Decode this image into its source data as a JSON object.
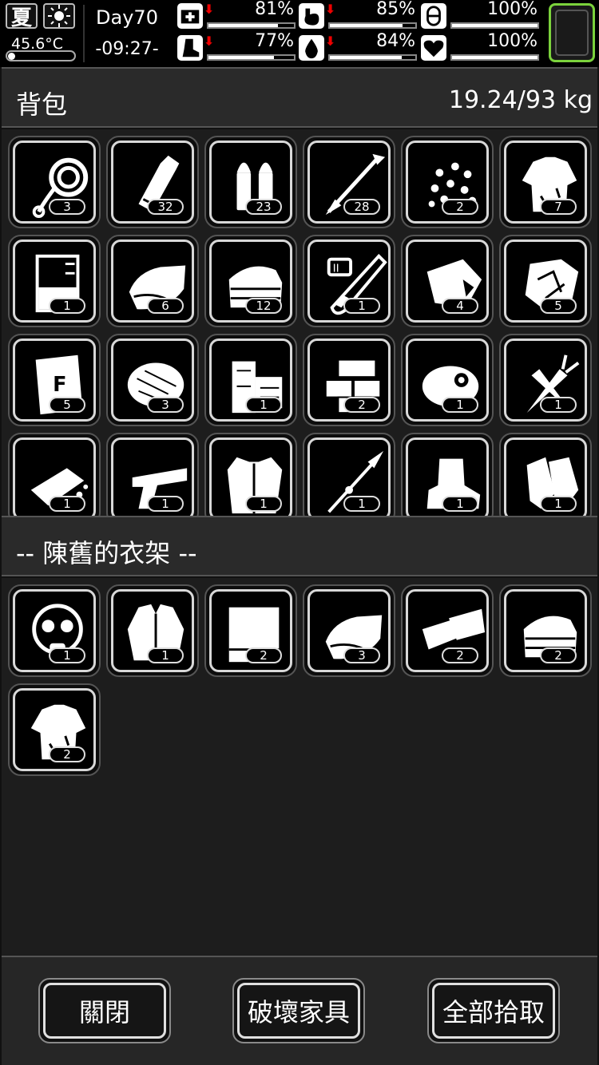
{
  "hud": {
    "season": "夏",
    "weather_icon": "sun-icon",
    "temperature": "45.6°C",
    "day": "Day70",
    "time": "-09:27-",
    "stats": [
      {
        "id": "health",
        "icon": "medkit-icon",
        "value": "81%",
        "fill": 0.81,
        "falling": true
      },
      {
        "id": "hunger",
        "icon": "stomach-icon",
        "value": "85%",
        "fill": 0.85,
        "falling": true
      },
      {
        "id": "medicine",
        "icon": "pill-icon",
        "value": "100%",
        "fill": 1.0,
        "falling": false
      },
      {
        "id": "stamina",
        "icon": "boot-icon",
        "value": "77%",
        "fill": 0.77,
        "falling": true
      },
      {
        "id": "thirst",
        "icon": "water-drop-icon",
        "value": "84%",
        "fill": 0.84,
        "falling": true
      },
      {
        "id": "mood",
        "icon": "heart-icon",
        "value": "100%",
        "fill": 1.0,
        "falling": false
      }
    ],
    "arrow_glyph": "⬇"
  },
  "backpack": {
    "title": "背包",
    "weight": "19.24/93 kg",
    "items": [
      {
        "name": "rope",
        "count": "3"
      },
      {
        "name": "bottle",
        "count": "32"
      },
      {
        "name": "bullets",
        "count": "23"
      },
      {
        "name": "arrow",
        "count": "28"
      },
      {
        "name": "seeds",
        "count": "2"
      },
      {
        "name": "torn-shirt",
        "count": "7"
      },
      {
        "name": "beaker",
        "count": "1"
      },
      {
        "name": "cloth",
        "count": "6"
      },
      {
        "name": "folded-cloth",
        "count": "12"
      },
      {
        "name": "test-tube",
        "count": "1"
      },
      {
        "name": "meat",
        "count": "4"
      },
      {
        "name": "crumpled-paper",
        "count": "5"
      },
      {
        "name": "fertilizer-bag",
        "count": "5"
      },
      {
        "name": "fiber-bundle",
        "count": "3"
      },
      {
        "name": "wood-planks",
        "count": "1"
      },
      {
        "name": "bricks",
        "count": "2"
      },
      {
        "name": "raw-meat",
        "count": "1"
      },
      {
        "name": "carrots",
        "count": "1"
      },
      {
        "name": "soap-bar",
        "count": "1"
      },
      {
        "name": "pistol",
        "count": "1"
      },
      {
        "name": "fur-vest",
        "count": "1"
      },
      {
        "name": "spear",
        "count": "1"
      },
      {
        "name": "fur-boots",
        "count": "1"
      },
      {
        "name": "gloves",
        "count": "1"
      }
    ]
  },
  "container": {
    "title": "-- 陳舊的衣架 --",
    "items": [
      {
        "name": "gas-mask",
        "count": "1"
      },
      {
        "name": "jacket",
        "count": "1"
      },
      {
        "name": "blanket",
        "count": "2"
      },
      {
        "name": "cloth",
        "count": "3"
      },
      {
        "name": "rags",
        "count": "2"
      },
      {
        "name": "folded-cloth",
        "count": "2"
      },
      {
        "name": "torn-shirt",
        "count": "2"
      }
    ]
  },
  "footer": {
    "close_label": "關閉",
    "destroy_label": "破壞家具",
    "take_all_label": "全部拾取"
  }
}
